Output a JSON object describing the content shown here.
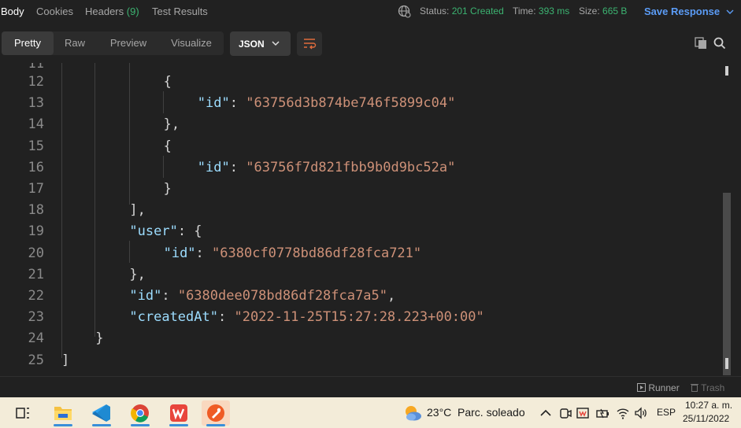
{
  "response_tabs": {
    "body": "Body",
    "cookies": "Cookies",
    "headers": "Headers",
    "headers_count": "(9)",
    "test_results": "Test Results"
  },
  "status": {
    "status_label": "Status:",
    "status_value": "201 Created",
    "time_label": "Time:",
    "time_value": "393 ms",
    "size_label": "Size:",
    "size_value": "665 B",
    "save_response": "Save Response"
  },
  "view_modes": {
    "pretty": "Pretty",
    "raw": "Raw",
    "preview": "Preview",
    "visualize": "Visualize",
    "format": "JSON"
  },
  "code": {
    "partial_top_number": "11",
    "lines": [
      {
        "n": "12",
        "indent": 6,
        "parts": [
          [
            "punc",
            "{"
          ]
        ]
      },
      {
        "n": "13",
        "indent": 8,
        "parts": [
          [
            "key",
            "\"id\""
          ],
          [
            "punc",
            ": "
          ],
          [
            "str",
            "\"63756d3b874be746f5899c04\""
          ]
        ]
      },
      {
        "n": "14",
        "indent": 6,
        "parts": [
          [
            "punc",
            "},"
          ]
        ]
      },
      {
        "n": "15",
        "indent": 6,
        "parts": [
          [
            "punc",
            "{"
          ]
        ]
      },
      {
        "n": "16",
        "indent": 8,
        "parts": [
          [
            "key",
            "\"id\""
          ],
          [
            "punc",
            ": "
          ],
          [
            "str",
            "\"63756f7d821fbb9b0d9bc52a\""
          ]
        ]
      },
      {
        "n": "17",
        "indent": 6,
        "parts": [
          [
            "punc",
            "}"
          ]
        ]
      },
      {
        "n": "18",
        "indent": 4,
        "parts": [
          [
            "punc",
            "],"
          ]
        ]
      },
      {
        "n": "19",
        "indent": 4,
        "parts": [
          [
            "key",
            "\"user\""
          ],
          [
            "punc",
            ": {"
          ]
        ]
      },
      {
        "n": "20",
        "indent": 6,
        "parts": [
          [
            "key",
            "\"id\""
          ],
          [
            "punc",
            ": "
          ],
          [
            "str",
            "\"6380cf0778bd86df28fca721\""
          ]
        ]
      },
      {
        "n": "21",
        "indent": 4,
        "parts": [
          [
            "punc",
            "},"
          ]
        ]
      },
      {
        "n": "22",
        "indent": 4,
        "parts": [
          [
            "key",
            "\"id\""
          ],
          [
            "punc",
            ": "
          ],
          [
            "str",
            "\"6380dee078bd86df28fca7a5\""
          ],
          [
            "punc",
            ","
          ]
        ]
      },
      {
        "n": "23",
        "indent": 4,
        "parts": [
          [
            "key",
            "\"createdAt\""
          ],
          [
            "punc",
            ": "
          ],
          [
            "str",
            "\"2022-11-25T15:27:28.223+00:00\""
          ]
        ]
      },
      {
        "n": "24",
        "indent": 2,
        "parts": [
          [
            "punc",
            "}"
          ]
        ]
      },
      {
        "n": "25",
        "indent": 0,
        "parts": [
          [
            "punc",
            "]"
          ]
        ]
      }
    ]
  },
  "footer": {
    "runner": "Runner",
    "trash": "Trash"
  },
  "taskbar": {
    "weather_temp": "23°C",
    "weather_desc": "Parc. soleado",
    "language": "ESP",
    "time": "10:27 a. m.",
    "date": "25/11/2022",
    "apps": [
      "task-view",
      "file-explorer",
      "vs-code",
      "chrome",
      "wps-office",
      "postman"
    ]
  },
  "colors": {
    "background": "#212121",
    "json_key": "#9cdcfe",
    "json_string": "#ce9178",
    "status_ok": "#3cb371",
    "accent_blue": "#5b9cf6",
    "taskbar": "#f3ecd9"
  }
}
